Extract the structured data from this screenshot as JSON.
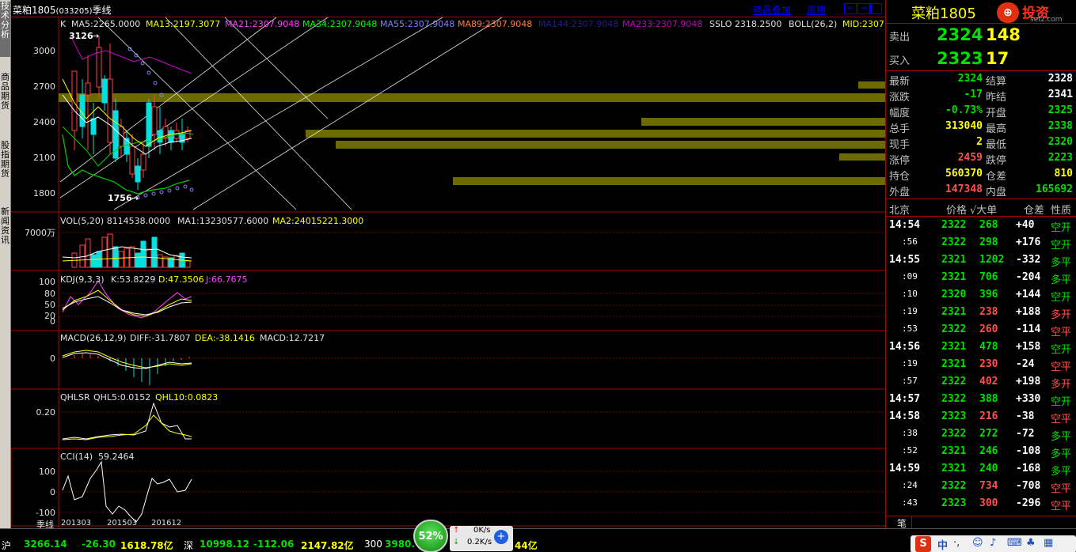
{
  "title": {
    "name": "菜粕1805",
    "code": "(033205)",
    "period": "季线"
  },
  "toolbar": {
    "overlay": "商品叠加",
    "cycle": "周期"
  },
  "left_tabs": [
    "技术分析",
    "商品期货",
    "股指期货",
    "新闻资讯"
  ],
  "panes": {
    "main": {
      "indicator": "K",
      "ma5": "MA5:2265.0000",
      "ma13": "MA13:2197.3077",
      "ma21": "MA21:2307.9048",
      "ma34": "MA34:2307.9048",
      "ma55": "MA55:2307.9048",
      "ma89": "MA89:2307.9048",
      "ma144": "MA144:2307.9048",
      "ma233": "MA233:2307.9048",
      "sslo": "SSLO 2318.2500",
      "boll": "BOLL(26,2)",
      "mid": "MID:2307",
      "high_label": "3126",
      "low_label": "1756",
      "y_ticks": [
        "3000",
        "2700",
        "2400",
        "2100",
        "1800"
      ]
    },
    "vol": {
      "title": "VOL(5,20) 8114538.0000",
      "ma1": "MA1:13230577.6000",
      "ma2": "MA2:24015221.3000",
      "y_tick": "7000万"
    },
    "kdj": {
      "title": "KDJ(9,3,3)",
      "k": "K:53.8229",
      "d": "D:47.3506",
      "j": "J:66.7675",
      "y_ticks": [
        "100",
        "80",
        "50",
        "20",
        "0"
      ]
    },
    "macd": {
      "title": "MACD(26,12,9)",
      "diff": "DIFF:-31.7807",
      "dea": "DEA:-38.1416",
      "macd": "MACD:12.7217",
      "y_tick": "0"
    },
    "qhlsr": {
      "title": "QHLSR",
      "qhl5": "QHL5:0.0152",
      "qhl10": "QHL10:0.0823",
      "y_tick": "0.20"
    },
    "cci": {
      "title": "CCI(14)",
      "value": "59.2464",
      "y_ticks": [
        "100",
        "0",
        "-100"
      ]
    }
  },
  "xaxis": {
    "label": "季线",
    "dates": [
      "201303",
      "201503",
      "201612"
    ]
  },
  "quote": {
    "sell_label": "卖出",
    "sell_price": "2324",
    "sell_vol": "148",
    "buy_label": "买入",
    "buy_price": "2323",
    "buy_vol": "17",
    "rows": [
      {
        "l1": "最新",
        "v1": "2324",
        "c1": "g",
        "l2": "结算",
        "v2": "2328",
        "c2": "w"
      },
      {
        "l1": "涨跌",
        "v1": "-17",
        "c1": "g",
        "l2": "昨结",
        "v2": "2341",
        "c2": "w"
      },
      {
        "l1": "幅度",
        "v1": "-0.73%",
        "c1": "g",
        "l2": "开盘",
        "v2": "2325",
        "c2": "g"
      },
      {
        "l1": "总手",
        "v1": "313040",
        "c1": "y",
        "l2": "最高",
        "v2": "2338",
        "c2": "g"
      },
      {
        "l1": "现手",
        "v1": "2",
        "c1": "y",
        "l2": "最低",
        "v2": "2320",
        "c2": "g"
      },
      {
        "l1": "涨停",
        "v1": "2459",
        "c1": "r",
        "l2": "跌停",
        "v2": "2223",
        "c2": "g"
      },
      {
        "l1": "持仓",
        "v1": "560370",
        "c1": "y",
        "l2": "仓差",
        "v2": "810",
        "c2": "y"
      },
      {
        "l1": "外盘",
        "v1": "147348",
        "c1": "r",
        "l2": "内盘",
        "v2": "165692",
        "c2": "g"
      }
    ]
  },
  "ticks_header": {
    "time": "北京",
    "price": "价格",
    "vol": "√大单",
    "oi": "仓差",
    "nature": "性质"
  },
  "ticks": [
    {
      "t": "14:54",
      "p": "2322",
      "v": "268",
      "vc": "g",
      "o": "+40",
      "n": "空开",
      "nc": "g"
    },
    {
      "t": ":56",
      "p": "2322",
      "v": "298",
      "vc": "g",
      "o": "+176",
      "n": "空开",
      "nc": "g"
    },
    {
      "t": "14:55",
      "p": "2321",
      "v": "1202",
      "vc": "g",
      "o": "-332",
      "n": "多平",
      "nc": "g"
    },
    {
      "t": ":09",
      "p": "2321",
      "v": "706",
      "vc": "g",
      "o": "-204",
      "n": "多平",
      "nc": "g"
    },
    {
      "t": ":10",
      "p": "2320",
      "v": "396",
      "vc": "g",
      "o": "+144",
      "n": "空开",
      "nc": "g"
    },
    {
      "t": ":19",
      "p": "2321",
      "v": "238",
      "vc": "r",
      "o": "+188",
      "n": "多开",
      "nc": "r"
    },
    {
      "t": ":53",
      "p": "2322",
      "v": "260",
      "vc": "r",
      "o": "-114",
      "n": "空平",
      "nc": "r"
    },
    {
      "t": "14:56",
      "p": "2321",
      "v": "478",
      "vc": "g",
      "o": "+158",
      "n": "空开",
      "nc": "g"
    },
    {
      "t": ":19",
      "p": "2321",
      "v": "230",
      "vc": "r",
      "o": "-24",
      "n": "空平",
      "nc": "r"
    },
    {
      "t": ":57",
      "p": "2322",
      "v": "402",
      "vc": "r",
      "o": "+198",
      "n": "多开",
      "nc": "r"
    },
    {
      "t": "14:57",
      "p": "2322",
      "v": "388",
      "vc": "g",
      "o": "+330",
      "n": "空开",
      "nc": "g"
    },
    {
      "t": "14:58",
      "p": "2323",
      "v": "216",
      "vc": "r",
      "o": "-38",
      "n": "空平",
      "nc": "r"
    },
    {
      "t": ":38",
      "p": "2322",
      "v": "272",
      "vc": "g",
      "o": "-72",
      "n": "多平",
      "nc": "g"
    },
    {
      "t": ":52",
      "p": "2321",
      "v": "246",
      "vc": "g",
      "o": "-108",
      "n": "多平",
      "nc": "g"
    },
    {
      "t": "14:59",
      "p": "2321",
      "v": "240",
      "vc": "g",
      "o": "-168",
      "n": "多平",
      "nc": "g"
    },
    {
      "t": ":24",
      "p": "2322",
      "v": "734",
      "vc": "r",
      "o": "-708",
      "n": "空平",
      "nc": "r"
    },
    {
      "t": ":43",
      "p": "2323",
      "v": "300",
      "vc": "r",
      "o": "-296",
      "n": "空平",
      "nc": "r"
    }
  ],
  "footer_char": "笔",
  "status": {
    "sh_label": "沪",
    "sh_index": "3266.14",
    "sh_change": "-26.30",
    "sh_amount": "1618.78亿",
    "sz_label": "深",
    "sz_index": "10998.12",
    "sz_change": "-112.06",
    "sz_amount": "2147.82亿",
    "hs300_label": "300",
    "hs300_value": "3980.",
    "extra": "44亿",
    "cpu": "52%",
    "net_up": "0K/s",
    "net_down": "0.2K/s"
  },
  "logo": {
    "text": "投资",
    "domain": "setz.com"
  }
}
